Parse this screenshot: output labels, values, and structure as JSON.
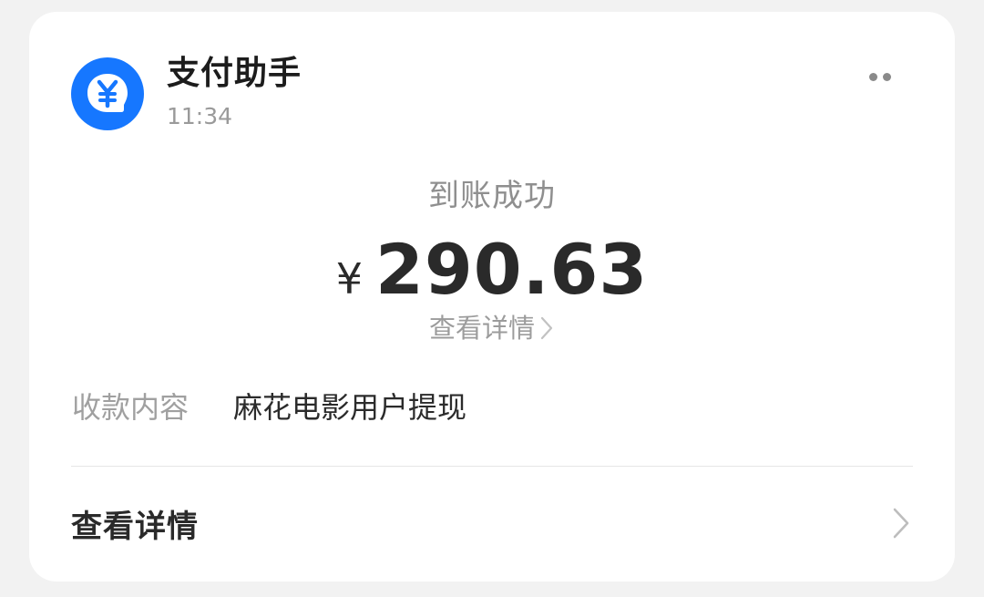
{
  "notification": {
    "app_name": "支付助手",
    "time": "11:34",
    "icon": "yuan-chat-icon",
    "accent_color": "#1677ff",
    "more_icon": "more-dots-icon"
  },
  "payment": {
    "status": "到账成功",
    "currency_symbol": "¥",
    "amount": "290.63",
    "detail_link": "查看详情"
  },
  "content": {
    "label": "收款内容",
    "value": "麻花电影用户提现"
  },
  "footer": {
    "label": "查看详情",
    "icon": "chevron-right-icon"
  }
}
